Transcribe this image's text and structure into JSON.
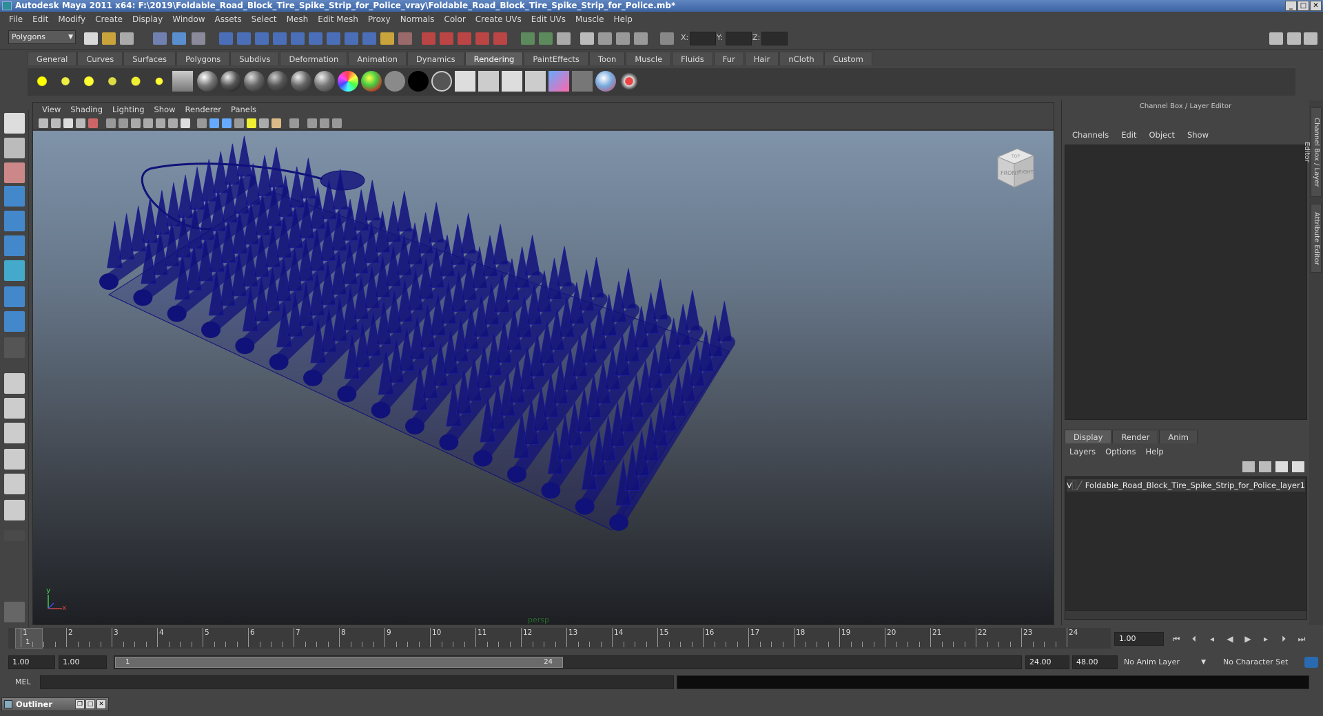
{
  "window": {
    "title": "Autodesk Maya 2011 x64: F:\\2019\\Foldable_Road_Block_Tire_Spike_Strip_for_Police_vray\\Foldable_Road_Block_Tire_Spike_Strip_for_Police.mb*",
    "minimize": "_",
    "maximize": "□",
    "close": "✕"
  },
  "menubar": [
    "File",
    "Edit",
    "Modify",
    "Create",
    "Display",
    "Window",
    "Assets",
    "Select",
    "Mesh",
    "Edit Mesh",
    "Proxy",
    "Normals",
    "Color",
    "Create UVs",
    "Edit UVs",
    "Muscle",
    "Help"
  ],
  "statusline": {
    "mode": "Polygons",
    "coords": {
      "x_label": "X:",
      "y_label": "Y:",
      "z_label": "Z:"
    }
  },
  "shelf": {
    "tabs": [
      "General",
      "Curves",
      "Surfaces",
      "Polygons",
      "Subdivs",
      "Deformation",
      "Animation",
      "Dynamics",
      "Rendering",
      "PaintEffects",
      "Toon",
      "Muscle",
      "Fluids",
      "Fur",
      "Hair",
      "nCloth",
      "Custom"
    ],
    "active_tab": "Rendering"
  },
  "viewport": {
    "menu": [
      "View",
      "Shading",
      "Lighting",
      "Show",
      "Renderer",
      "Panels"
    ],
    "camera": "persp",
    "axis_y": "y",
    "axis_x": "x",
    "cube_front": "FRONT",
    "cube_right": "RIGHT",
    "cube_top": "TOP",
    "wire_color": "#11117a"
  },
  "channelbox": {
    "title": "Channel Box / Layer Editor",
    "menu": [
      "Channels",
      "Edit",
      "Object",
      "Show"
    ]
  },
  "layereditor": {
    "tabs": [
      "Display",
      "Render",
      "Anim"
    ],
    "active_tab": "Display",
    "menu": [
      "Layers",
      "Options",
      "Help"
    ],
    "layers": [
      {
        "visible": "V",
        "name": "Foldable_Road_Block_Tire_Spike_Strip_for_Police_layer1"
      }
    ]
  },
  "sidetabs": {
    "channel_box": "Channel Box / Layer Editor",
    "attribute_editor": "Attribute Editor"
  },
  "timeslider": {
    "ticks": [
      "1",
      "2",
      "3",
      "4",
      "5",
      "6",
      "7",
      "8",
      "9",
      "10",
      "11",
      "12",
      "13",
      "14",
      "15",
      "16",
      "17",
      "18",
      "19",
      "20",
      "21",
      "22",
      "23",
      "24"
    ],
    "current_frame_marker": "1",
    "current_frame": "1.00"
  },
  "rangeslider": {
    "start": "1.00",
    "playback_start": "1.00",
    "range_left": "1",
    "range_right": "24",
    "playback_end": "24.00",
    "end": "48.00",
    "anim_layer": "No Anim Layer",
    "character_set": "No Character Set"
  },
  "commandline": {
    "label": "MEL"
  },
  "outliner": {
    "title": "Outliner"
  }
}
